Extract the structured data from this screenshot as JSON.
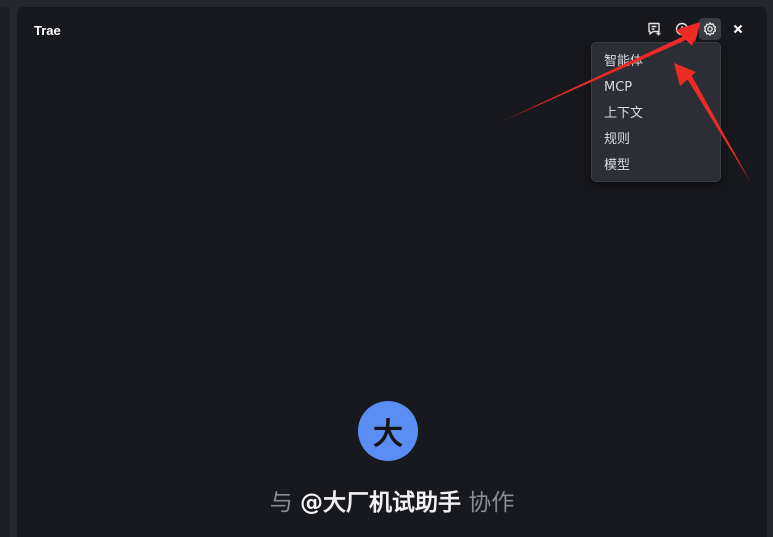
{
  "app": {
    "title": "Trae"
  },
  "toolbar": {
    "buttons": [
      {
        "icon": "new-chat-icon"
      },
      {
        "icon": "history-icon"
      },
      {
        "icon": "gear-icon"
      },
      {
        "icon": "close-icon"
      }
    ]
  },
  "settings_menu": {
    "items": [
      {
        "label": "智能体"
      },
      {
        "label": "MCP"
      },
      {
        "label": "上下文"
      },
      {
        "label": "规则"
      },
      {
        "label": "模型"
      }
    ]
  },
  "welcome": {
    "avatar_text": "大",
    "prefix": "与 ",
    "agent_name": "@大厂机试助手",
    "suffix": " 协作"
  },
  "colors": {
    "panel_bg": "#18191e",
    "menu_bg": "#2c2e35",
    "avatar_bg": "#5b8ef4",
    "annotation_arrow": "#ee2a24"
  }
}
